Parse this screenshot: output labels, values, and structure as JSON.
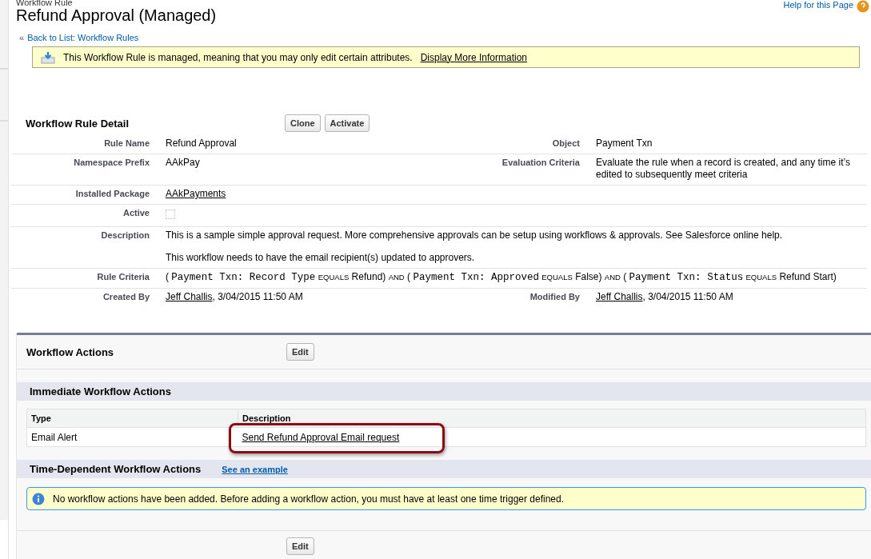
{
  "header": {
    "crumb": "Workflow Rule",
    "title": "Refund Approval (Managed)",
    "help_link": "Help for this Page",
    "back_link": {
      "prefix": "«",
      "label": "Back to List: Workflow Rules"
    }
  },
  "managed_notice": {
    "text": "This Workflow Rule is managed, meaning that you may only edit certain attributes.",
    "link": "Display More Information"
  },
  "detail": {
    "title": "Workflow Rule Detail",
    "buttons": [
      "Clone",
      "Activate"
    ],
    "rows": [
      {
        "left": {
          "label": "Rule Name",
          "kind": "text",
          "value": "Refund Approval"
        },
        "right": {
          "label": "Object",
          "kind": "text",
          "value": "Payment Txn"
        }
      },
      {
        "left": {
          "label": "Namespace Prefix",
          "kind": "text",
          "value": "AAkPay"
        },
        "right": {
          "label": "Evaluation Criteria",
          "kind": "text",
          "value": "Evaluate the rule when a record is created, and any time it’s edited to subsequently meet criteria"
        }
      },
      {
        "left": {
          "label": "Installed Package",
          "kind": "link",
          "value": "AAkPayments"
        }
      },
      {
        "left": {
          "label": "Active",
          "kind": "checkbox",
          "checked": false
        }
      },
      {
        "left": {
          "label": "Description",
          "kind": "paragraphs",
          "paragraphs": [
            "This is a sample simple approval request. More comprehensive approvals can be setup using workflows & approvals. See Salesforce online help.",
            "This workflow needs to have the email recipient(s) updated to approvers."
          ]
        }
      },
      {
        "left": {
          "label": "Rule Criteria",
          "kind": "criteria",
          "parts": [
            {
              "kind": "punct",
              "text": "("
            },
            {
              "kind": "field",
              "text": "Payment Txn: Record Type"
            },
            {
              "kind": "op",
              "text": "EQUALS"
            },
            {
              "kind": "value",
              "text": "Refund)"
            },
            {
              "kind": "op",
              "text": "AND"
            },
            {
              "kind": "punct",
              "text": "("
            },
            {
              "kind": "field",
              "text": "Payment Txn: Approved"
            },
            {
              "kind": "op",
              "text": "EQUALS"
            },
            {
              "kind": "value",
              "text": "False)"
            },
            {
              "kind": "op",
              "text": "AND"
            },
            {
              "kind": "punct",
              "text": "("
            },
            {
              "kind": "field",
              "text": "Payment Txn: Status"
            },
            {
              "kind": "op",
              "text": "EQUALS"
            },
            {
              "kind": "value",
              "text": "Refund Start)"
            }
          ]
        }
      },
      {
        "left": {
          "label": "Created By",
          "kind": "user",
          "link": "Jeff Challis",
          "suffix": ", 3/04/2015 11:50 AM"
        },
        "right": {
          "label": "Modified By",
          "kind": "user",
          "link": "Jeff Challis",
          "suffix": ", 3/04/2015 11:50 AM"
        }
      }
    ]
  },
  "actions": {
    "title": "Workflow Actions",
    "button": "Edit",
    "immediate": {
      "title": "Immediate Workflow Actions",
      "columns": [
        "Type",
        "Description"
      ],
      "rows": [
        {
          "type": "Email Alert",
          "description": "Send Refund Approval Email request",
          "highlighted": true
        }
      ]
    },
    "time_dependent": {
      "title": "Time-Dependent Workflow Actions",
      "link": "See an example",
      "notice": "No workflow actions have been added. Before adding a workflow action, you must have at least one time trigger defined."
    },
    "bottom_button": "Edit"
  }
}
